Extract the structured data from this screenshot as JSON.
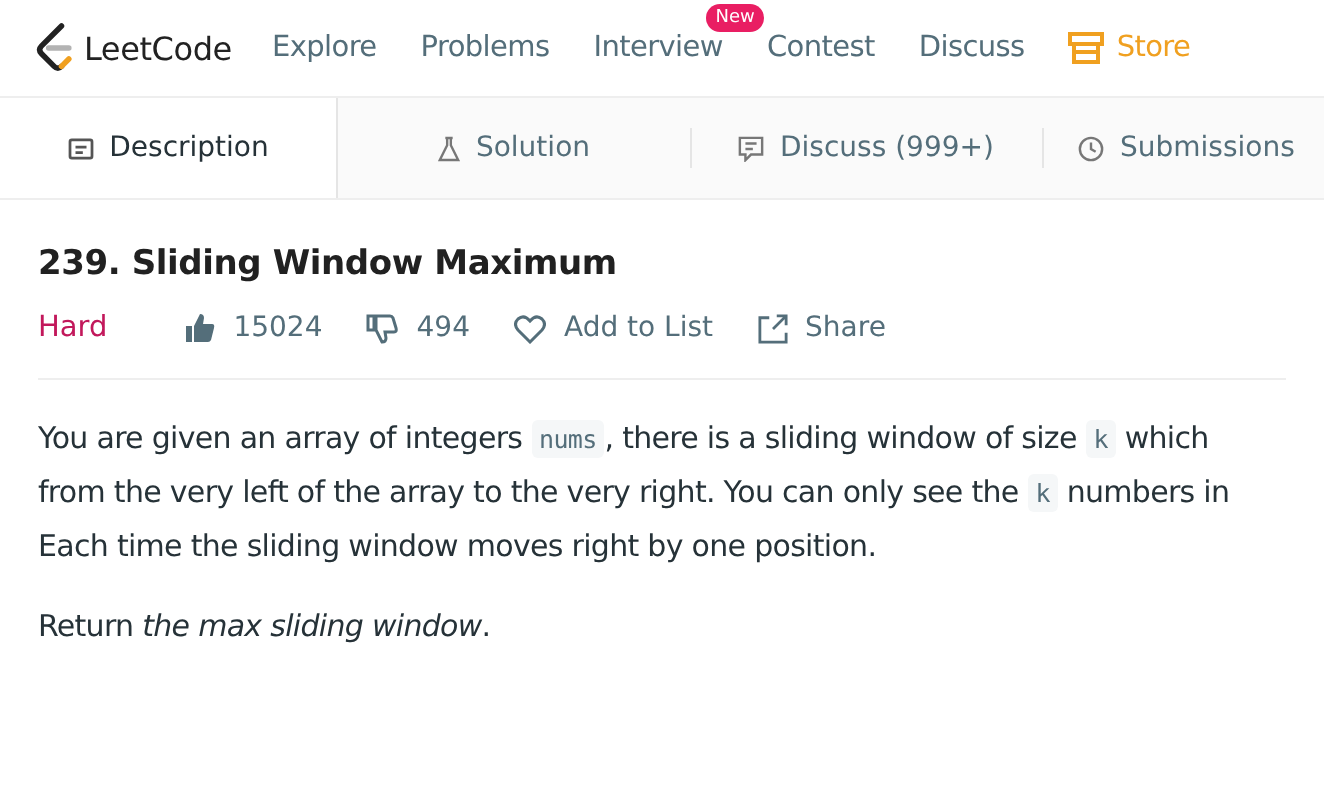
{
  "header": {
    "logo": "LeetCode",
    "nav": [
      {
        "label": "Explore",
        "kind": "link"
      },
      {
        "label": "Problems",
        "kind": "link"
      },
      {
        "label": "Interview",
        "kind": "link",
        "badge": "New"
      },
      {
        "label": "Contest",
        "kind": "link"
      },
      {
        "label": "Discuss",
        "kind": "link"
      },
      {
        "label": "Store",
        "kind": "store"
      }
    ]
  },
  "tabs": [
    {
      "label": "Description",
      "kind": "description",
      "selected": true
    },
    {
      "label": "Solution",
      "kind": "solution",
      "selected": false
    },
    {
      "label": "Discuss (999+)",
      "kind": "discuss",
      "selected": false
    },
    {
      "label": "Submissions",
      "kind": "submissions",
      "selected": false
    }
  ],
  "problem": {
    "title": "239. Sliding Window Maximum",
    "difficulty": "Hard",
    "likes": "15024",
    "dislikes": "494",
    "add_to_list": "Add to List",
    "share": "Share"
  },
  "description": {
    "lines": [
      [
        {
          "kind": "text",
          "text": "You are given an array of integers "
        },
        {
          "kind": "code",
          "text": "nums"
        },
        {
          "kind": "text",
          "text": ", there is a sliding window of size "
        },
        {
          "kind": "code",
          "text": "k"
        },
        {
          "kind": "text",
          "text": " which"
        }
      ],
      [
        {
          "kind": "text",
          "text": "from the very left of the array to the very right. You can only see the "
        },
        {
          "kind": "code",
          "text": "k"
        },
        {
          "kind": "text",
          "text": " numbers in"
        }
      ],
      [
        {
          "kind": "text",
          "text": "Each time the sliding window moves right by one position."
        }
      ]
    ],
    "closing": "Return *the max sliding window*."
  }
}
